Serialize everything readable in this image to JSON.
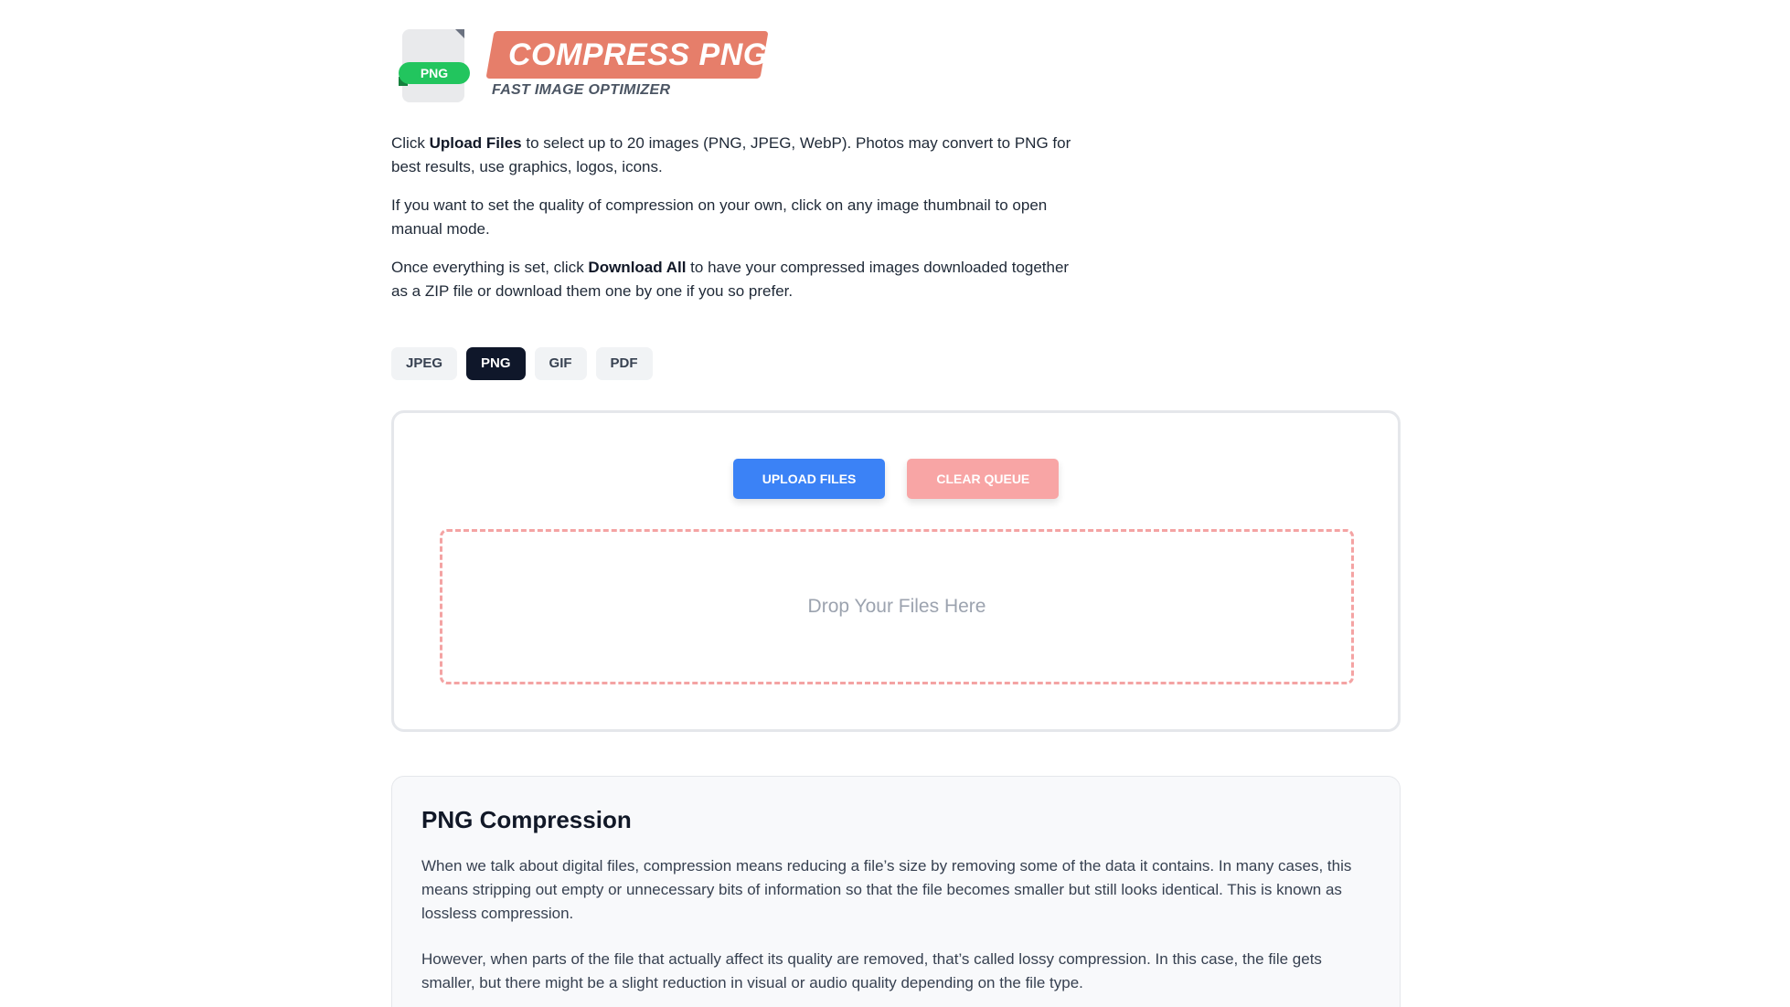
{
  "brand": {
    "icon_tag": "PNG",
    "title": "COMPRESS PNG",
    "subtitle": "FAST IMAGE OPTIMIZER"
  },
  "intro": {
    "p1_before": "Click ",
    "p1_bold": "Upload Files",
    "p1_after": " to select up to 20 images (PNG, JPEG, WebP). Photos may convert to PNG for best results, use graphics, logos, icons.",
    "p2": "If you want to set the quality of compression on your own, click on any image thumbnail to open manual mode.",
    "p3_before": "Once everything is set, click ",
    "p3_bold": "Download All",
    "p3_after": " to have your compressed images downloaded together as a ZIP file or download them one by one if you so prefer."
  },
  "tabs": [
    {
      "label": "JPEG",
      "active": false
    },
    {
      "label": "PNG",
      "active": true
    },
    {
      "label": "GIF",
      "active": false
    },
    {
      "label": "PDF",
      "active": false
    }
  ],
  "uploader": {
    "upload_label": "UPLOAD FILES",
    "clear_label": "CLEAR QUEUE",
    "drop_text": "Drop Your Files Here"
  },
  "info": {
    "heading": "PNG Compression",
    "p1": "When we talk about digital files, compression means reducing a file’s size by removing some of the data it contains. In many cases, this means stripping out empty or unnecessary bits of information so that the file becomes smaller but still looks identical. This is known as lossless compression.",
    "p2": "However, when parts of the file that actually affect its quality are removed, that’s called lossy compression. In this case, the file gets smaller, but there might be a slight reduction in visual or audio quality depending on the file type."
  },
  "colors": {
    "brand_banner": "#e67e6a",
    "icon_tag": "#22c55e",
    "active_tab": "#0f172a",
    "upload_button": "#3b82f6",
    "clear_button": "#f8a5a5",
    "dropzone_border": "#f4a3a3"
  }
}
